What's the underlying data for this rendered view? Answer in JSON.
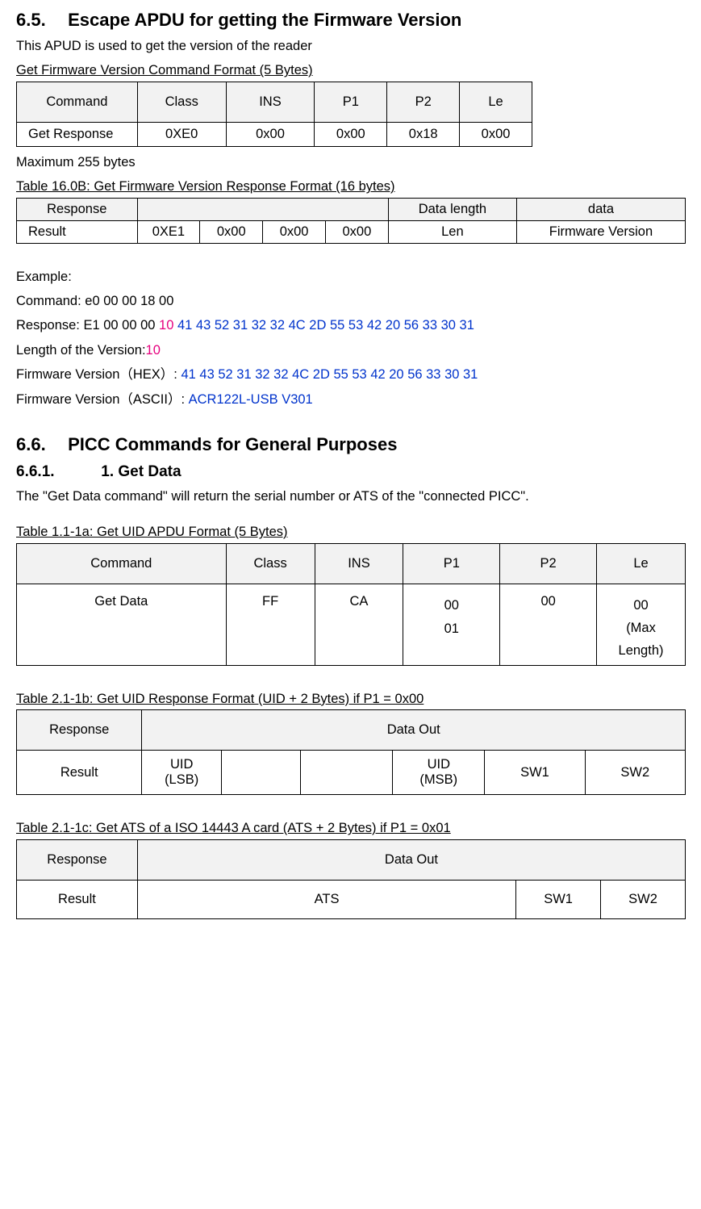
{
  "s65": {
    "heading_num": "6.5.",
    "heading_text": "Escape APDU for getting the Firmware Version",
    "intro": "This APUD  is used to get the version of the reader",
    "cmd_caption": "Get Firmware Version Command Format (5 Bytes)",
    "cmd_header": [
      "Command",
      "Class",
      "INS",
      "P1",
      "P2",
      "Le"
    ],
    "cmd_row": [
      "Get Response",
      "0XE0",
      "0x00",
      "0x00",
      "0x18",
      "0x00"
    ],
    "maxbytes": "Maximum 255 bytes",
    "resp_caption": "Table 16.0B: Get Firmware Version Response Format (16 bytes)",
    "resp_header": [
      "Response",
      "Data length",
      "data"
    ],
    "resp_row": [
      "Result",
      "0XE1",
      "0x00",
      "0x00",
      "0x00",
      "Len",
      "Firmware Version"
    ],
    "example_label": "Example:",
    "cmd_example": "Command: e0 00 00 18 00",
    "resp_prefix": "Response:  E1 00 00 00 ",
    "resp_pink": "10",
    "resp_blue": " 41 43 52 31 32 32 4C 2D 55 53 42 20 56 33 30 31",
    "len_prefix": "Length of the Version:",
    "len_pink": "10",
    "fw_hex_prefix": "Firmware Version（HEX）: ",
    "fw_hex_blue": "41 43 52 31 32 32 4C 2D 55 53 42 20 56 33 30 31",
    "fw_ascii_prefix": "Firmware Version（ASCII）: ",
    "fw_ascii_blue": "ACR122L-USB V301"
  },
  "s66": {
    "heading_num": "6.6.",
    "heading_text": "PICC Commands for General Purposes",
    "sub_num": "6.6.1.",
    "sub_text": "1. Get Data",
    "intro": "The \"Get Data command\" will return the serial number or ATS of the \"connected PICC\".",
    "t1a_caption": "Table 1.1-1a: Get UID APDU Format (5 Bytes)",
    "t1a_header": [
      "Command",
      "Class",
      "INS",
      "P1",
      "P2",
      "Le"
    ],
    "t1a_row_cmd": "Get Data",
    "t1a_row_class": "FF",
    "t1a_row_ins": "CA",
    "t1a_row_p1": "00\n01",
    "t1a_row_p2": "00",
    "t1a_row_le": "00\n(Max Length)",
    "t1b_caption": "Table 2.1-1b: Get UID Response Format (UID + 2 Bytes) if P1 = 0x00",
    "t1b_h_response": "Response",
    "t1b_h_dataout": "Data Out",
    "t1b_r_result": "Result",
    "t1b_r_uidlsb": "UID\n(LSB)",
    "t1b_r_uidmsb": "UID\n(MSB)",
    "t1b_r_sw1": "SW1",
    "t1b_r_sw2": "SW2",
    "t1c_caption": "Table 2.1-1c: Get ATS of a ISO 14443 A card (ATS + 2 Bytes) if P1 = 0x01",
    "t1c_h_response": "Response",
    "t1c_h_dataout": "Data Out",
    "t1c_r_result": "Result",
    "t1c_r_ats": "ATS",
    "t1c_r_sw1": "SW1",
    "t1c_r_sw2": "SW2"
  }
}
